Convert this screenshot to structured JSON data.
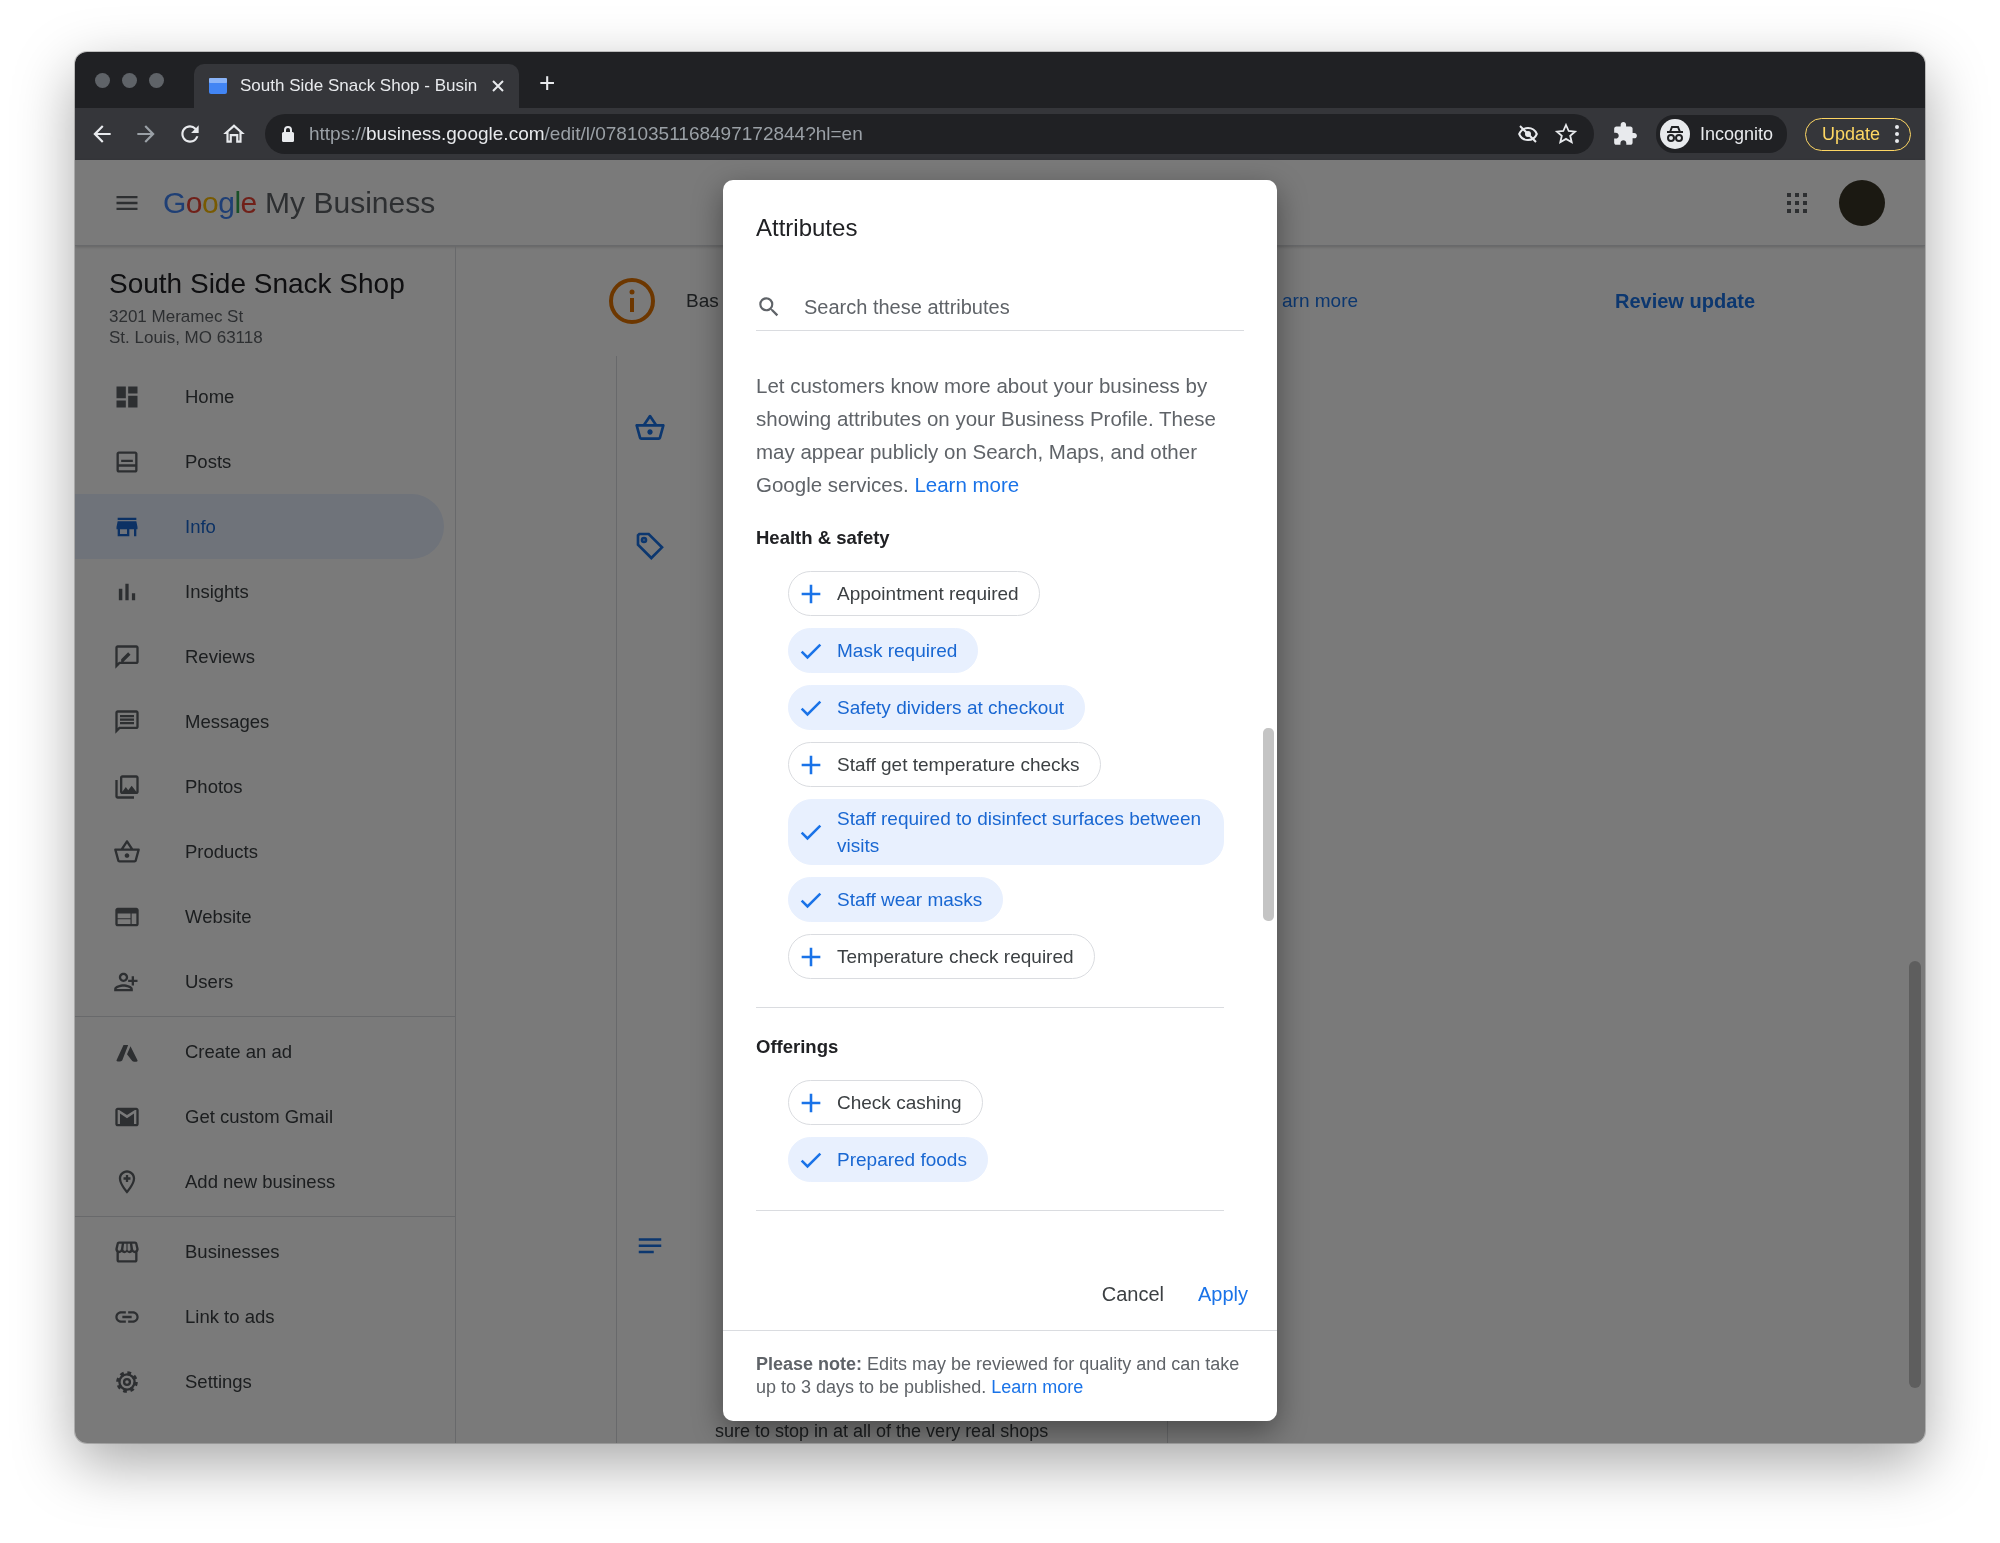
{
  "browser": {
    "tab_title": "South Side Snack Shop - Busin",
    "new_tab": "+",
    "url_scheme": "https://",
    "url_host": "business.google.com",
    "url_path": "/edit/l/07810351168497172844?hl=en",
    "profile": "Incognito",
    "update": "Update"
  },
  "app_header": {
    "logo_brand": "Google",
    "logo_product": "My Business"
  },
  "sidebar": {
    "business_name": "South Side Snack Shop",
    "address": [
      "3201 Meramec St",
      "St. Louis, MO 63118"
    ],
    "groups": [
      [
        {
          "label": "Home",
          "selected": false
        },
        {
          "label": "Posts",
          "selected": false
        },
        {
          "label": "Info",
          "selected": true
        },
        {
          "label": "Insights",
          "selected": false
        },
        {
          "label": "Reviews",
          "selected": false
        },
        {
          "label": "Messages",
          "selected": false
        },
        {
          "label": "Photos",
          "selected": false
        },
        {
          "label": "Products",
          "selected": false
        },
        {
          "label": "Website",
          "selected": false
        },
        {
          "label": "Users",
          "selected": false
        }
      ],
      [
        {
          "label": "Create an ad",
          "selected": false
        },
        {
          "label": "Get custom Gmail",
          "selected": false
        },
        {
          "label": "Add new business",
          "selected": false
        }
      ],
      [
        {
          "label": "Businesses",
          "selected": false
        },
        {
          "label": "Link to ads",
          "selected": false
        },
        {
          "label": "Settings",
          "selected": false
        }
      ]
    ]
  },
  "main": {
    "banner": {
      "text": "Bas",
      "link": "arn more",
      "action": "Review update"
    },
    "footer_text": "sure to stop in at all of the very real shops"
  },
  "dialog": {
    "title": "Attributes",
    "search": {
      "placeholder": "Search these attributes"
    },
    "intro": "Let customers know more about your business by showing attributes on your Business Profile. These may appear publicly on Search, Maps, and other Google services.",
    "intro_link": "Learn more",
    "sections": [
      {
        "heading": "Health & safety",
        "chips": [
          {
            "label": "Appointment required",
            "selected": false
          },
          {
            "label": "Mask required",
            "selected": true
          },
          {
            "label": "Safety dividers at checkout",
            "selected": true
          },
          {
            "label": "Staff get temperature checks",
            "selected": false
          },
          {
            "label": "Staff required to disinfect surfaces between visits",
            "selected": true
          },
          {
            "label": "Staff wear masks",
            "selected": true
          },
          {
            "label": "Temperature check required",
            "selected": false
          }
        ]
      },
      {
        "heading": "Offerings",
        "chips": [
          {
            "label": "Check cashing",
            "selected": false
          },
          {
            "label": "Prepared foods",
            "selected": true
          }
        ]
      }
    ],
    "buttons": {
      "cancel": "Cancel",
      "apply": "Apply"
    },
    "note": "**Please note:** Edits may be reviewed for quality and can take up to 3 days to be published.",
    "note_link": "Learn more"
  }
}
